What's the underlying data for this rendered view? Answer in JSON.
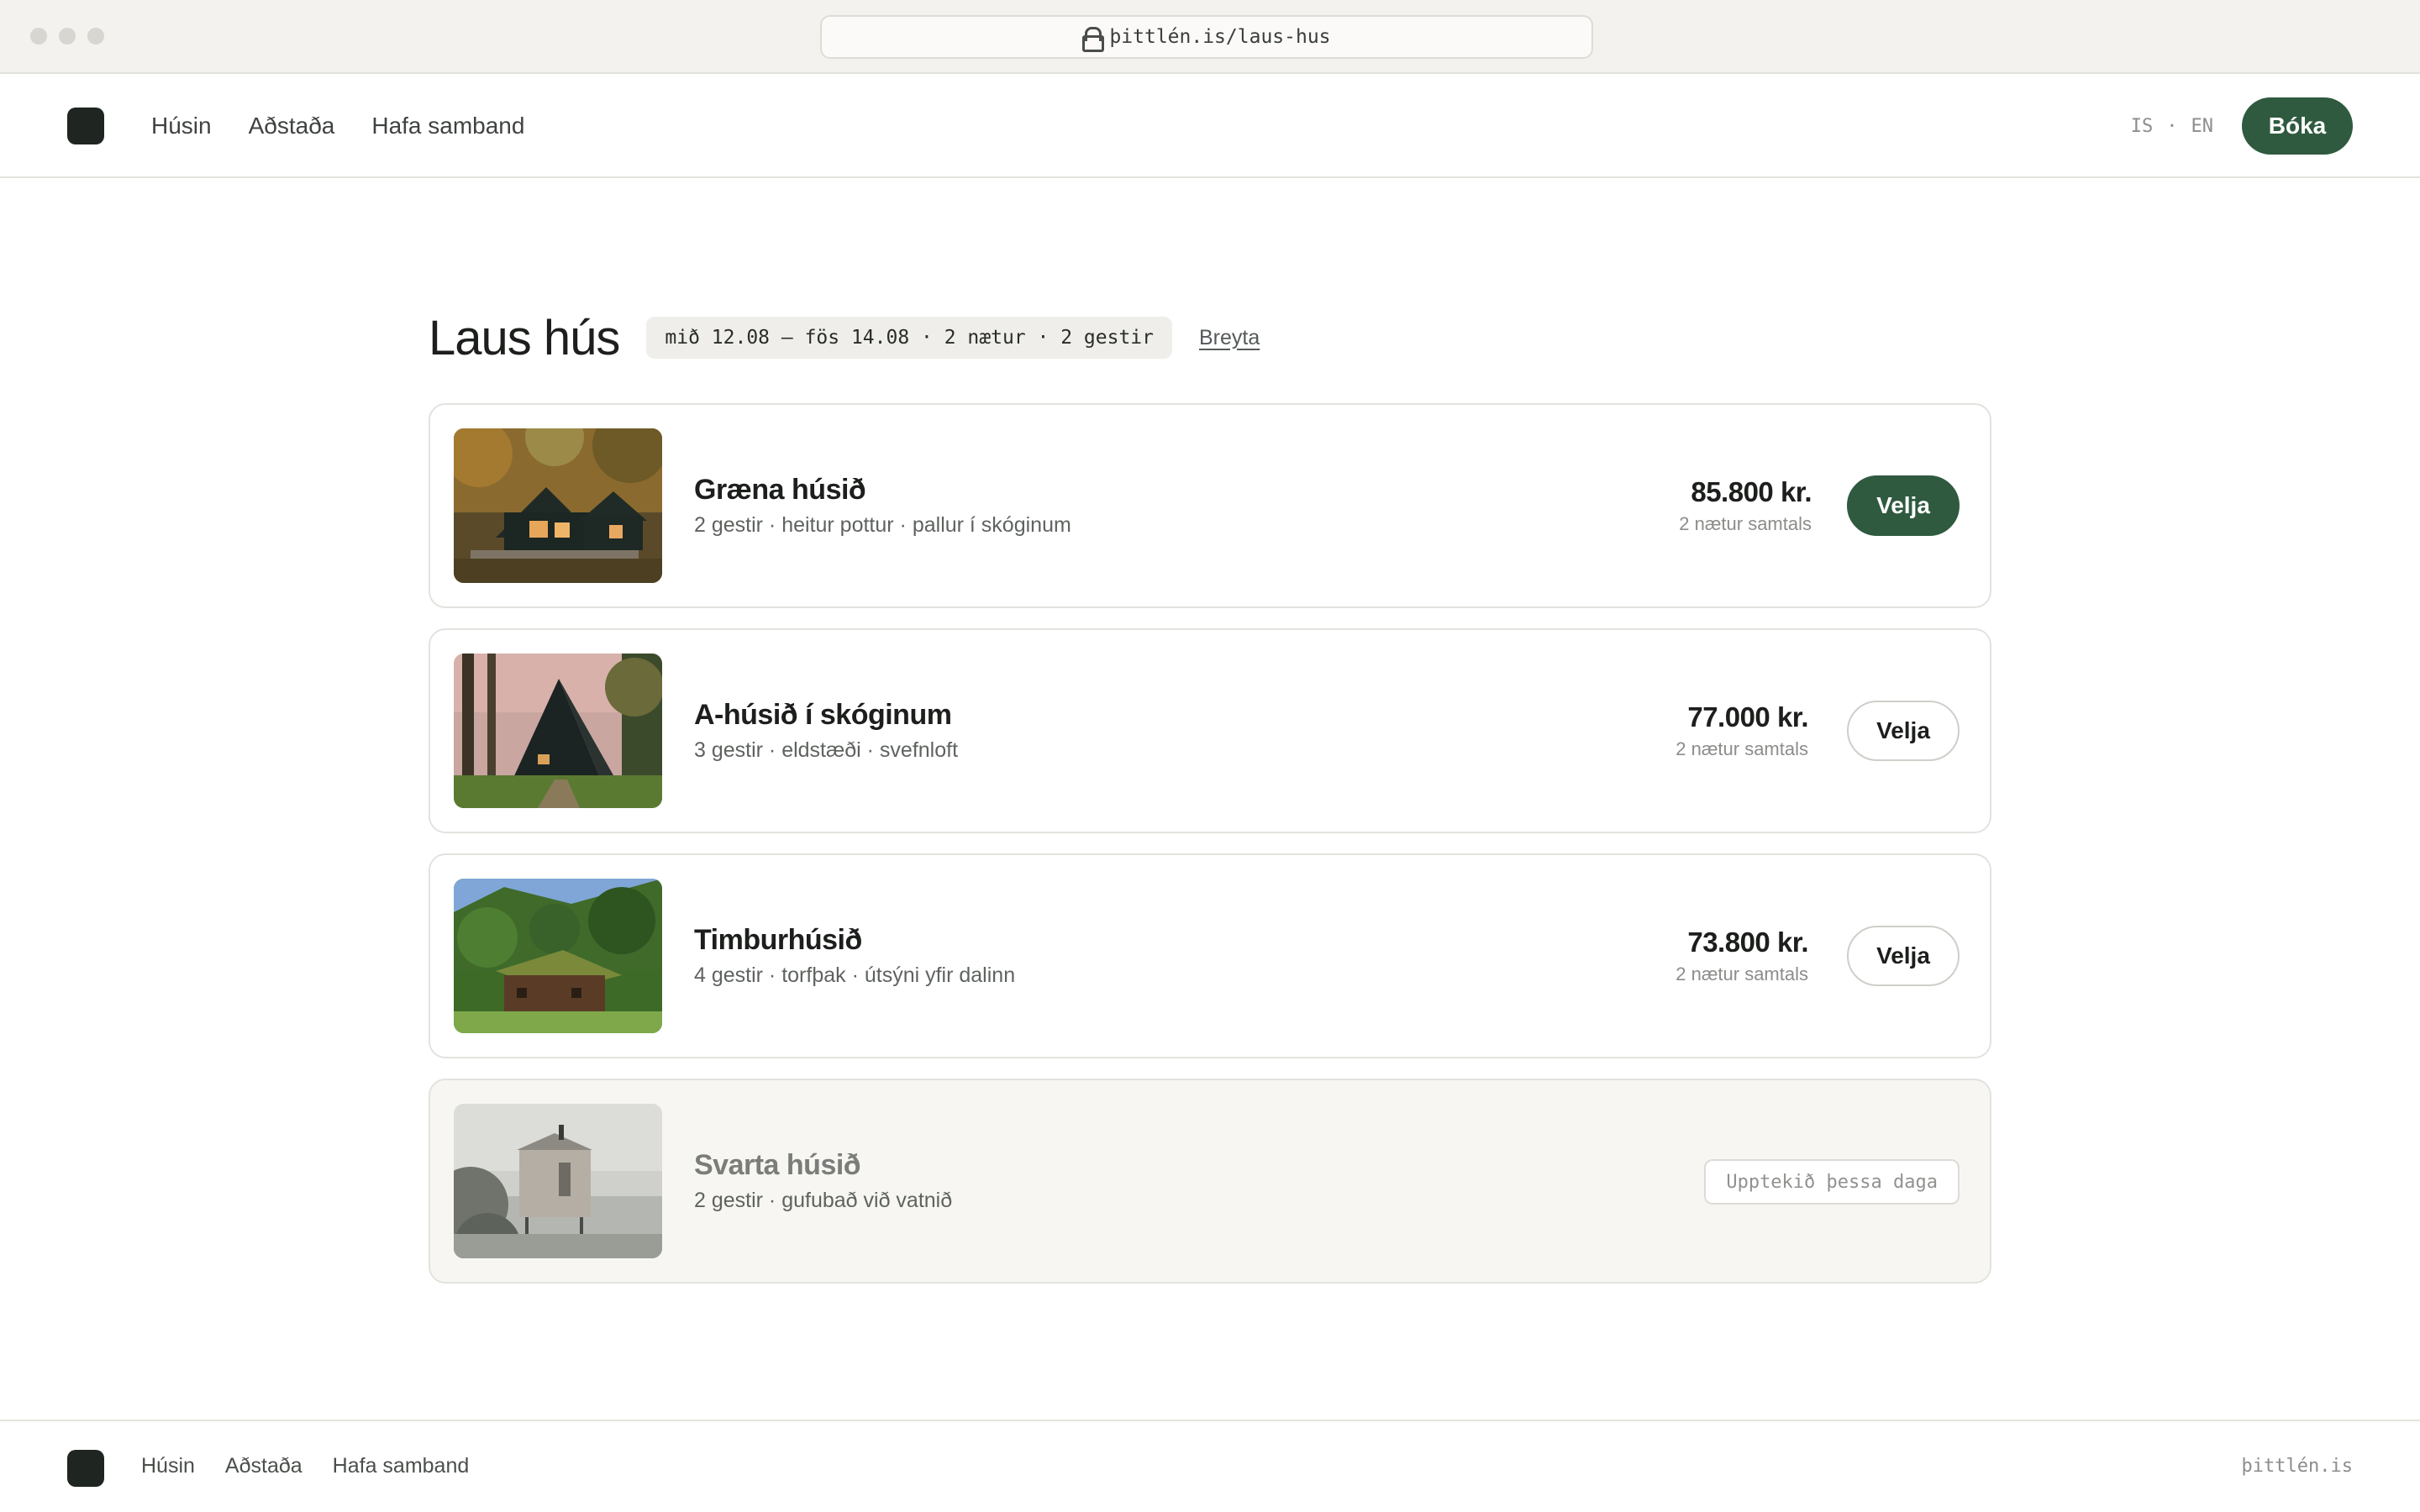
{
  "browser": {
    "url": "þittlén.is/laus-hus",
    "lock_icon": "lock-icon"
  },
  "header": {
    "nav": [
      "Húsin",
      "Aðstaða",
      "Hafa samband"
    ],
    "lang_is": "IS",
    "lang_sep": "·",
    "lang_en": "EN",
    "book_label": "Bóka"
  },
  "main": {
    "title": "Laus hús",
    "dates": "mið 12.08 – fös 14.08 · 2 nætur · 2 gestir",
    "change_label": "Breyta",
    "cabins": [
      {
        "name": "Græna húsið",
        "meta": "2 gestir · heitur pottur · pallur í skóginum",
        "price": "85.800 kr.",
        "nights": "2 nætur samtals",
        "select_label": "Velja"
      },
      {
        "name": "A-húsið í skóginum",
        "meta": "3 gestir · eldstæði · svefnloft",
        "price": "77.000 kr.",
        "nights": "2 nætur samtals",
        "select_label": "Velja"
      },
      {
        "name": "Timburhúsið",
        "meta": "4 gestir · torfþak · útsýni yfir dalinn",
        "price": "73.800 kr.",
        "nights": "2 nætur samtals",
        "select_label": "Velja"
      },
      {
        "name": "Svarta húsið",
        "meta": "2 gestir · gufubað við vatnið",
        "status": "Upptekið þessa daga"
      }
    ]
  },
  "footer": {
    "nav": [
      "Húsin",
      "Aðstaða",
      "Hafa samband"
    ],
    "domain": "þittlén.is"
  },
  "colors": {
    "accent": "#2f5a3f",
    "logo": "#1f2520",
    "background": "#ffffff",
    "chip": "#efeeea"
  }
}
